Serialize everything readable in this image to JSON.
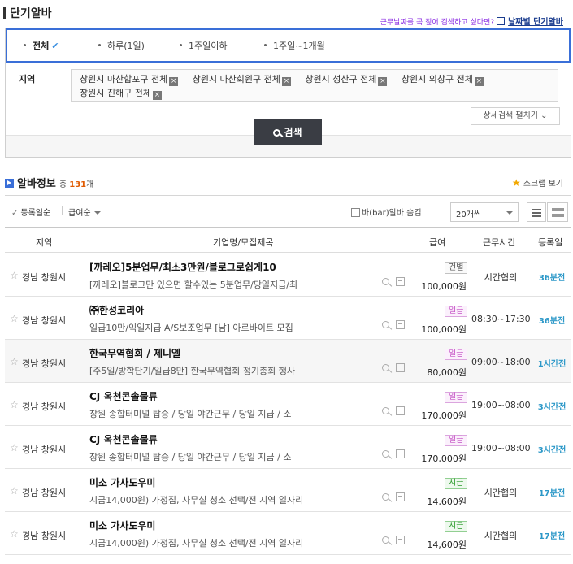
{
  "header": {
    "title": "단기알바",
    "hint": "근무날짜를 콕 짚어 검색하고 싶다면?",
    "hint_link": "날짜별 단기알바"
  },
  "period_tabs": [
    {
      "label": "전체",
      "active": true
    },
    {
      "label": "하루(1일)",
      "active": false
    },
    {
      "label": "1주일이하",
      "active": false
    },
    {
      "label": "1주일~1개월",
      "active": false
    }
  ],
  "region": {
    "label": "지역",
    "chips": [
      "창원시 마산합포구 전체",
      "창원시 마산회원구 전체",
      "창원시 성산구 전체",
      "창원시 의창구 전체",
      "창원시 진해구 전체"
    ],
    "remove_icon": "×"
  },
  "search_button": "검색",
  "detail_toggle": "상세검색 펼치기 ⌄",
  "info": {
    "title": "알바정보",
    "count_prefix": "총",
    "count": "131",
    "count_suffix": "개",
    "scrap": "스크랩 보기"
  },
  "sort": {
    "by_date": "등록일순",
    "by_pay": "급여순",
    "hide_bar": "바(bar)알바 숨김",
    "per_page": "20개씩"
  },
  "columns": {
    "region": "지역",
    "title": "기업명/모집제목",
    "pay": "급여",
    "hours": "근무시간",
    "posted": "등록일"
  },
  "rows": [
    {
      "region": "경남 창원시",
      "company": "[까레오]5분업무/최소3만원/블로그로쉽게10",
      "job": "[까레오]블로그만 있으면 할수있는 5분업무/당일지급/최",
      "pay_type": "건별",
      "pay_class": "neg",
      "wage": "100,000원",
      "hours": "시간협의",
      "posted": "36분전",
      "highlight": false,
      "underline": false
    },
    {
      "region": "경남 창원시",
      "company": "㈜한성코리아",
      "job": "일급10만/익일지급 A/S보조업무 [남] 아르바이트 모집",
      "pay_type": "일급",
      "pay_class": "daily",
      "wage": "100,000원",
      "hours": "08:30~17:30",
      "posted": "36분전",
      "highlight": false,
      "underline": false
    },
    {
      "region": "경남 창원시",
      "company": "한국무역협회 / 제니엘",
      "job": "[주5일/방학단기/일급8만] 한국무역협회 정기총회 행사",
      "pay_type": "일급",
      "pay_class": "daily",
      "wage": "80,000원",
      "hours": "09:00~18:00",
      "posted": "1시간전",
      "highlight": true,
      "underline": true
    },
    {
      "region": "경남 창원시",
      "company": "CJ 옥천콘솔물류",
      "job": "창원 종합터미널 탑승 / 당일 야간근무 / 당일 지급 / 소",
      "pay_type": "일급",
      "pay_class": "daily",
      "wage": "170,000원",
      "hours": "19:00~08:00",
      "posted": "3시간전",
      "highlight": false,
      "underline": false
    },
    {
      "region": "경남 창원시",
      "company": "CJ 옥천콘솔물류",
      "job": "창원 종합터미널 탑승 / 당일 야간근무 / 당일 지급 / 소",
      "pay_type": "일급",
      "pay_class": "daily",
      "wage": "170,000원",
      "hours": "19:00~08:00",
      "posted": "3시간전",
      "highlight": false,
      "underline": false
    },
    {
      "region": "경남 창원시",
      "company": "미소 가사도우미",
      "job": "시급14,000원) 가정집, 사무실 청소 선택/전 지역 일자리",
      "pay_type": "시급",
      "pay_class": "hourly",
      "wage": "14,600원",
      "hours": "시간협의",
      "posted": "17분전",
      "highlight": false,
      "underline": false
    },
    {
      "region": "경남 창원시",
      "company": "미소 가사도우미",
      "job": "시급14,000원) 가정집, 사무실 청소 선택/전 지역 일자리",
      "pay_type": "시급",
      "pay_class": "hourly",
      "wage": "14,600원",
      "hours": "시간협의",
      "posted": "17분전",
      "highlight": false,
      "underline": false
    }
  ],
  "colors": {
    "accent": "#3a6fd8",
    "posted": "#2c98c8",
    "count": "#e05a00",
    "button": "#3a3d44"
  }
}
